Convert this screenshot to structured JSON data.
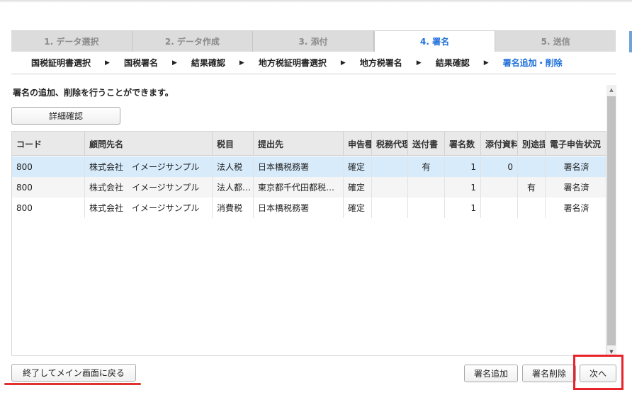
{
  "tabs": [
    {
      "label": "1. データ選択",
      "active": false
    },
    {
      "label": "2. データ作成",
      "active": false
    },
    {
      "label": "3. 添付",
      "active": false
    },
    {
      "label": "4. 署名",
      "active": true
    },
    {
      "label": "5. 送信",
      "active": false
    }
  ],
  "steps": [
    {
      "label": "国税証明書選択",
      "current": false
    },
    {
      "label": "国税署名",
      "current": false
    },
    {
      "label": "結果確認",
      "current": false
    },
    {
      "label": "地方税証明書選択",
      "current": false
    },
    {
      "label": "地方税署名",
      "current": false
    },
    {
      "label": "結果確認",
      "current": false
    },
    {
      "label": "署名追加・削除",
      "current": true
    }
  ],
  "description": "署名の追加、削除を行うことができます。",
  "detail_button": "詳細確認",
  "grid": {
    "columns": [
      "コード",
      "顧問先名",
      "税目",
      "提出先",
      "申告種",
      "税務代理",
      "送付書",
      "署名数",
      "添付資料",
      "別途提出",
      "電子申告状況"
    ],
    "rows": [
      {
        "code": "800",
        "client": "株式会社　イメージサンプル",
        "tax": "法人税",
        "office": "日本橋税務署",
        "type": "確定",
        "agent": "",
        "cover": "有",
        "sigs": "1",
        "attach": "0",
        "separate": "",
        "status": "署名済"
      },
      {
        "code": "800",
        "client": "株式会社　イメージサンプル",
        "tax": "法人都…",
        "office": "東京都千代田都税…",
        "type": "確定",
        "agent": "",
        "cover": "",
        "sigs": "1",
        "attach": "",
        "separate": "有",
        "status": "署名済"
      },
      {
        "code": "800",
        "client": "株式会社　イメージサンプル",
        "tax": "消費税",
        "office": "日本橋税務署",
        "type": "確定",
        "agent": "",
        "cover": "",
        "sigs": "1",
        "attach": "",
        "separate": "",
        "status": "署名済"
      }
    ]
  },
  "buttons": {
    "exit": "終了してメイン画面に戻る",
    "add_signature": "署名追加",
    "delete_signature": "署名削除",
    "next": "次へ"
  },
  "colors": {
    "accent": "#1e6fd9",
    "selected_row": "#d7ebfb",
    "highlight": "#e8232a"
  },
  "icons": {
    "step_separator": "triangle-right-icon",
    "scroll_up": "scroll-up-icon",
    "scroll_down": "scroll-down-icon"
  }
}
